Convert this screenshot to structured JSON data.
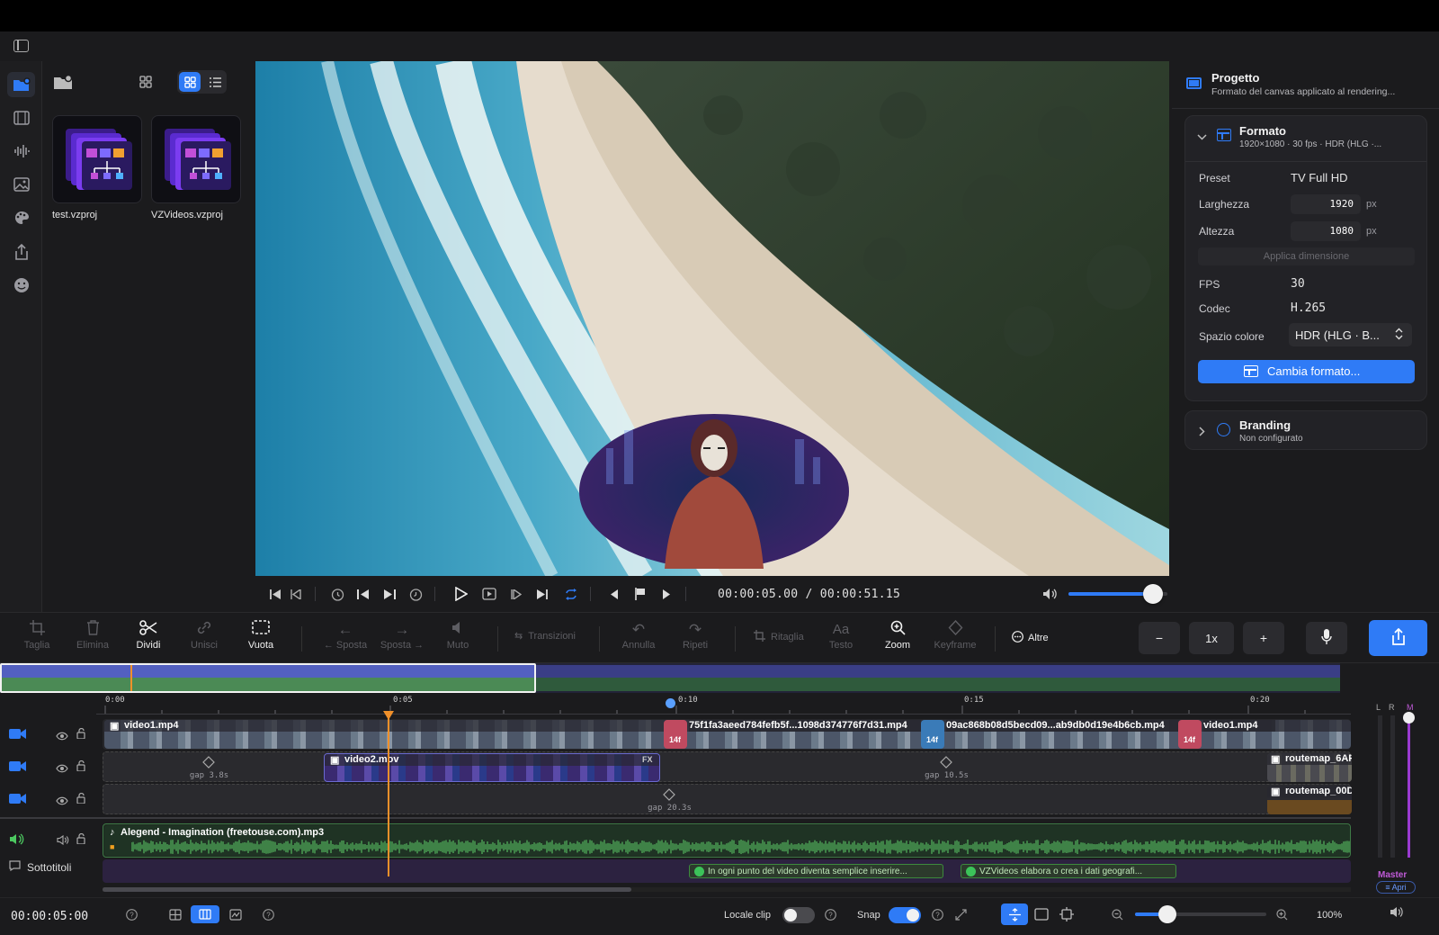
{
  "media": {
    "items": [
      {
        "name": "test.vzproj"
      },
      {
        "name": "VZVideos.vzproj"
      }
    ]
  },
  "transport": {
    "timecode": "00:00:05.00 / 00:00:51.15",
    "volume": 0.85
  },
  "inspector": {
    "project_title": "Progetto",
    "project_subtitle": "Formato del canvas applicato al rendering...",
    "format": {
      "title": "Formato",
      "summary": "1920×1080 · 30 fps · HDR (HLG ·...",
      "preset_label": "Preset",
      "preset_value": "TV Full HD",
      "width_label": "Larghezza",
      "width_value": "1920",
      "height_label": "Altezza",
      "height_value": "1080",
      "unit": "px",
      "apply_label": "Applica dimensione",
      "fps_label": "FPS",
      "fps_value": "30",
      "codec_label": "Codec",
      "codec_value": "H.265",
      "colorspace_label": "Spazio colore",
      "colorspace_value": "HDR (HLG · B...",
      "change_button": "Cambia formato..."
    },
    "branding": {
      "title": "Branding",
      "subtitle": "Non configurato"
    }
  },
  "toolbar": {
    "tools": [
      {
        "label": "Taglia",
        "icon": "crop-icon",
        "enabled": false
      },
      {
        "label": "Elimina",
        "icon": "trash-icon",
        "enabled": false
      },
      {
        "label": "Dividi",
        "icon": "scissors-icon",
        "enabled": true
      },
      {
        "label": "Unisci",
        "icon": "link-icon",
        "enabled": false
      },
      {
        "label": "Vuota",
        "icon": "blank-icon",
        "enabled": true
      }
    ],
    "move_left": "← Sposta",
    "move_right": "Sposta →",
    "mute": "Muto",
    "transitions": "Transizioni",
    "undo": "Annulla",
    "redo": "Ripeti",
    "crop": "Ritaglia",
    "text": "Testo",
    "text_glyph": "Aa",
    "zoom": "Zoom",
    "keyframe": "Keyframe",
    "more": "Altre",
    "speed": "1x"
  },
  "timeline": {
    "ruler": [
      "0:00",
      "0:05",
      "0:10",
      "0:15",
      "0:20"
    ],
    "clips": {
      "v1_a": "video1.mp4",
      "v1_b": "75f1fa3aeed784fefb5f...1098d374776f7d31.mp4",
      "v1_c": "09ac868b08d5becd09...ab9db0d19e4b6cb.mp4",
      "v1_d": "video1.mp4",
      "v2_a": "video2.mov",
      "v2_b": "routemap_6AF",
      "v3_a": "routemap_00D",
      "audio": "Alegend - Imagination (freetouse.com).mp3"
    },
    "transition_badge": "14f",
    "fx_badge": "FX",
    "gaps": {
      "v2_gap1": "gap 3.8s",
      "v2_gap2": "gap 10.5s",
      "v3_gap": "gap 20.3s"
    },
    "subtitles_label": "Sottotitoli",
    "subtitles": [
      "In ogni punto del video diventa semplice inserire...",
      "VZVideos elabora o crea i dati geografi..."
    ],
    "meter": {
      "l": "L",
      "r": "R",
      "m": "M",
      "master": "Master",
      "open": "Apri"
    }
  },
  "status": {
    "timecode": "00:00:05:00",
    "locale_clip": "Locale clip",
    "snap": "Snap",
    "zoom_pct": "100%"
  },
  "colors": {
    "accent": "#2f7bf6",
    "playhead": "#f0902a",
    "audio": "#5fd16a"
  }
}
